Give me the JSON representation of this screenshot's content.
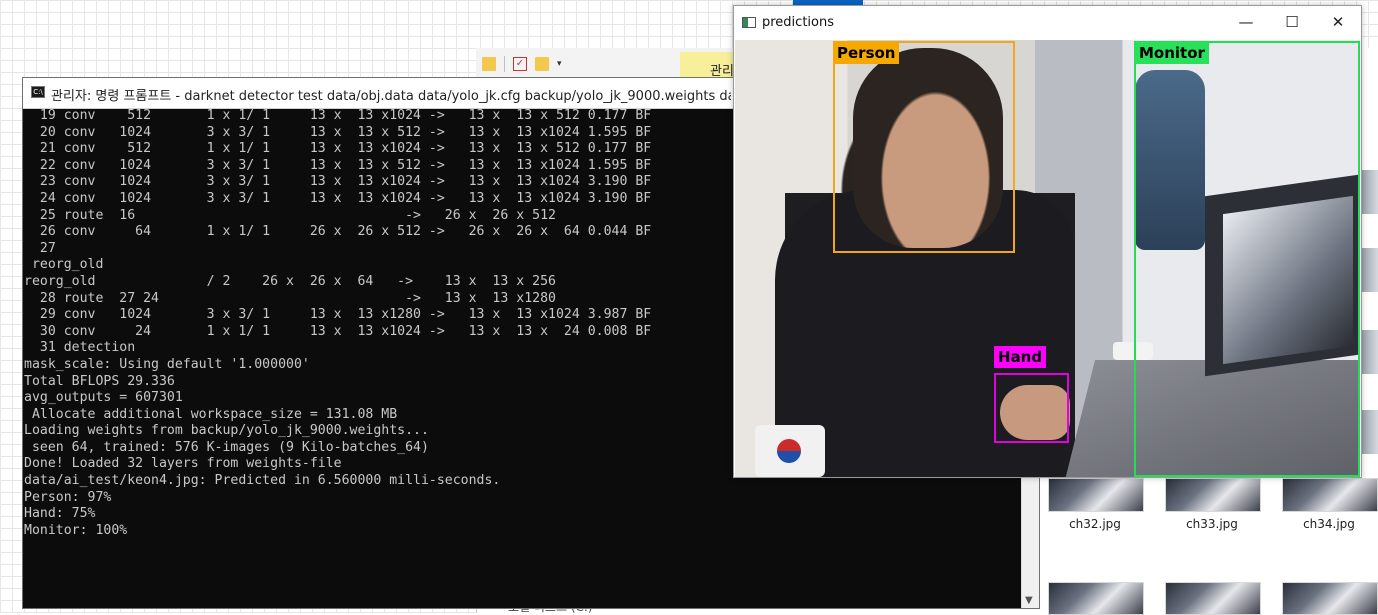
{
  "desktop": {
    "explorer_manage_label": "관리",
    "drive_label": "로컬 디스크 (C:)",
    "thumbnails": [
      {
        "label": "ch32.jpg"
      },
      {
        "label": "ch33.jpg"
      },
      {
        "label": "ch34.jpg"
      }
    ]
  },
  "cmd": {
    "title": "관리자: 명령 프롬프트 - darknet  detector test data/obj.data data/yolo_jk.cfg backup/yolo_jk_9000.weights data/ai_test/k",
    "lines": [
      "  19 conv    512       1 x 1/ 1     13 x  13 x1024 ->   13 x  13 x 512 0.177 BF",
      "  20 conv   1024       3 x 3/ 1     13 x  13 x 512 ->   13 x  13 x1024 1.595 BF",
      "  21 conv    512       1 x 1/ 1     13 x  13 x1024 ->   13 x  13 x 512 0.177 BF",
      "  22 conv   1024       3 x 3/ 1     13 x  13 x 512 ->   13 x  13 x1024 1.595 BF",
      "  23 conv   1024       3 x 3/ 1     13 x  13 x1024 ->   13 x  13 x1024 3.190 BF",
      "  24 conv   1024       3 x 3/ 1     13 x  13 x1024 ->   13 x  13 x1024 3.190 BF",
      "  25 route  16                                  ->   26 x  26 x 512",
      "  26 conv     64       1 x 1/ 1     26 x  26 x 512 ->   26 x  26 x  64 0.044 BF",
      "  27",
      " reorg_old",
      "reorg_old              / 2    26 x  26 x  64   ->    13 x  13 x 256",
      "  28 route  27 24                               ->   13 x  13 x1280",
      "  29 conv   1024       3 x 3/ 1     13 x  13 x1280 ->   13 x  13 x1024 3.987 BF",
      "  30 conv     24       1 x 1/ 1     13 x  13 x1024 ->   13 x  13 x  24 0.008 BF",
      "  31 detection",
      "mask_scale: Using default '1.000000'",
      "Total BFLOPS 29.336",
      "avg_outputs = 607301",
      " Allocate additional workspace_size = 131.08 MB",
      "Loading weights from backup/yolo_jk_9000.weights...",
      " seen 64, trained: 576 K-images (9 Kilo-batches_64)",
      "Done! Loaded 32 layers from weights-file",
      "data/ai_test/keon4.jpg: Predicted in 6.560000 milli-seconds.",
      "Person: 97%",
      "Hand: 75%",
      "Monitor: 100%"
    ]
  },
  "predictions": {
    "title": "predictions",
    "minimize": "—",
    "maximize": "☐",
    "close": "✕",
    "detections": [
      {
        "label": "Person",
        "color": "#f0a81a",
        "label_bg": "#f5a800"
      },
      {
        "label": "Monitor",
        "color": "#22dd55",
        "label_bg": "#28e05a"
      },
      {
        "label": "Hand",
        "color": "#e000e0",
        "label_bg": "#ff00ff"
      }
    ]
  }
}
